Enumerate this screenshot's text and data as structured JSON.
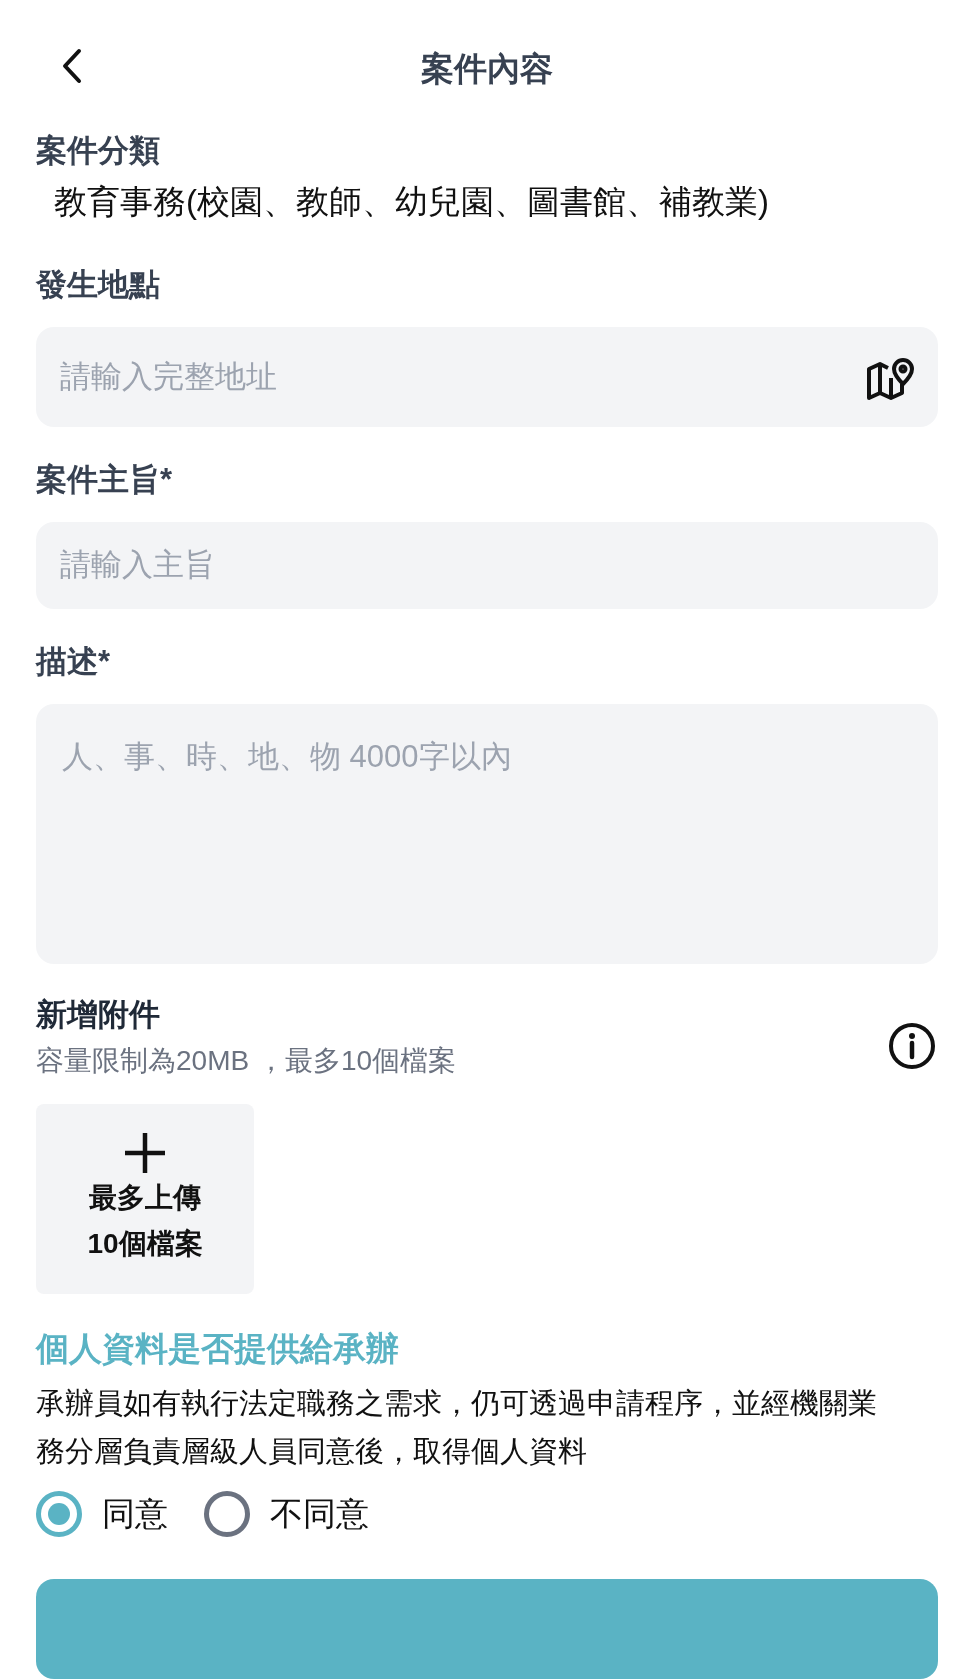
{
  "header": {
    "title": "案件內容"
  },
  "category": {
    "label": "案件分類",
    "value": "教育事務(校園、教師、幼兒園、圖書館、補教業)"
  },
  "location": {
    "label": "發生地點",
    "placeholder": "請輸入完整地址"
  },
  "subject": {
    "label": "案件主旨*",
    "placeholder": "請輸入主旨"
  },
  "description": {
    "label": "描述*",
    "placeholder": "人、事、時、地、物 4000字以內"
  },
  "attachments": {
    "title": "新增附件",
    "note": "容量限制為20MB ，最多10個檔案",
    "upload_lines": [
      "最多上傳",
      "10個檔案"
    ]
  },
  "privacy": {
    "title": "個人資料是否提供給承辦",
    "text": "承辦員如有執行法定職務之需求，仍可透過申請程序，並經機關業務分層負責層級人員同意後，取得個人資料",
    "options": [
      {
        "label": "同意",
        "selected": true
      },
      {
        "label": "不同意",
        "selected": false
      }
    ]
  }
}
